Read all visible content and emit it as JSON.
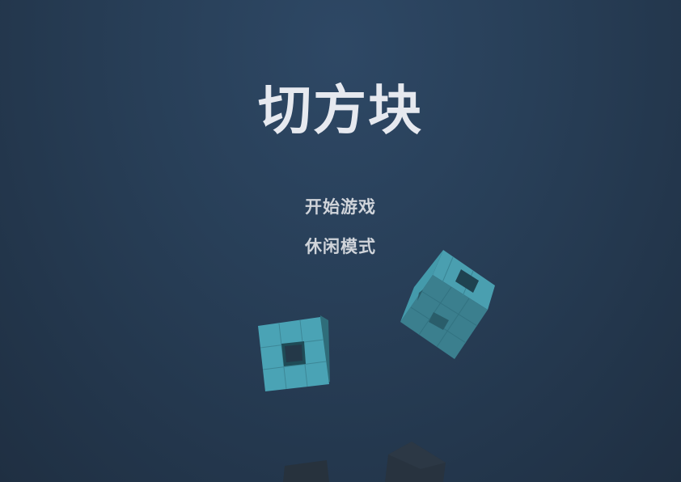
{
  "title": "切方块",
  "menu": {
    "start_game": "开始游戏",
    "casual_mode": "休闲模式"
  },
  "colors": {
    "cube_front": "#4a9fb0",
    "cube_side": "#3e8797",
    "cube_dark": "#2a3540",
    "title_text": "#e6e9ef",
    "menu_text": "#d0d4da"
  }
}
